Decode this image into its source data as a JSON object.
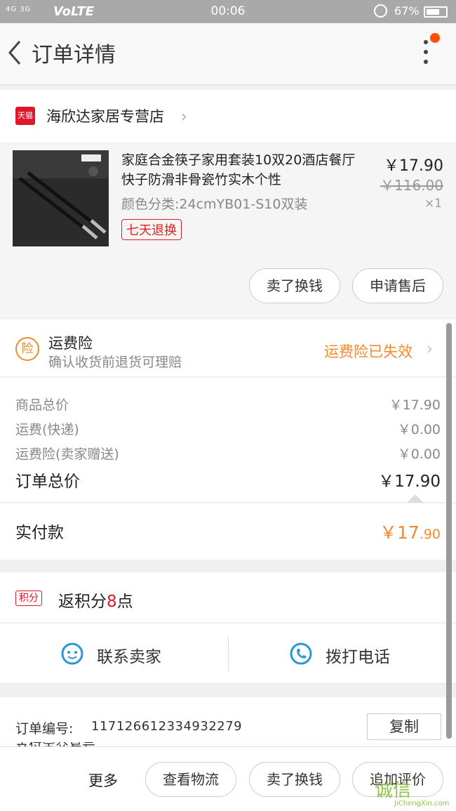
{
  "status_bar": {
    "signal": "4G 3G",
    "network": "VoLTE",
    "time": "00:06",
    "battery": "67%"
  },
  "nav": {
    "title": "订单详情"
  },
  "store": {
    "logo_text": "天猫",
    "name": "海欣达家居专营店"
  },
  "product": {
    "title": "家庭合金筷子家用套装10双20酒店餐厅快子防滑非骨瓷竹实木个性",
    "sku": "颜色分类:24cmYB01-S10双装",
    "badge": "七天退换",
    "price": "￥17.90",
    "original_price": "￥116.00",
    "qty": "×1",
    "actions": [
      "卖了换钱",
      "申请售后"
    ]
  },
  "insurance": {
    "icon": "险",
    "title": "运费险",
    "subtitle": "确认收货前退货可理赔",
    "status": "运费险已失效"
  },
  "fees": [
    {
      "label": "商品总价",
      "value": "￥17.90"
    },
    {
      "label": "运费(快递)",
      "value": "￥0.00"
    },
    {
      "label": "运费险(卖家赠送)",
      "value": "￥0.00"
    }
  ],
  "total": {
    "label": "订单总价",
    "value": "￥17.90"
  },
  "paid": {
    "label": "实付款",
    "currency": "￥",
    "integer": "17",
    "decimal": ".90"
  },
  "points": {
    "tag": "积分",
    "prefix": "返积分",
    "count": "8",
    "suffix": "点"
  },
  "contact": {
    "seller": "联系卖家",
    "phone": "拨打电话"
  },
  "order": {
    "label": "订单编号:",
    "number": "117126612334932279",
    "copy": "复制",
    "next_label": "支付宝交易号"
  },
  "bottom_bar": {
    "more": "更多",
    "buttons": [
      "查看物流",
      "卖了换钱",
      "追加评价"
    ]
  },
  "watermark": {
    "main": "诚信",
    "sub": "JiChengXin.com"
  },
  "colors": {
    "accent": "#f28a2c",
    "tmall": "#e0162b",
    "contact": "#2a96d8"
  }
}
